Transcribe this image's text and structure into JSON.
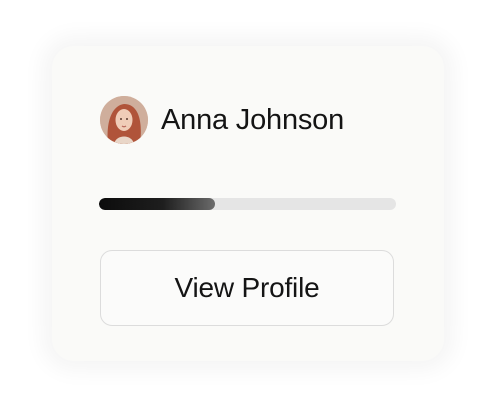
{
  "profile": {
    "name": "Anna Johnson",
    "avatar_icon": "user-avatar-photo"
  },
  "progress": {
    "value": 0.39
  },
  "actions": {
    "view_profile_label": "View Profile"
  },
  "colors": {
    "card_background": "#fafaf8",
    "progress_fill": "#111111",
    "progress_track": "#e5e5e5",
    "button_border": "#dcdcdc",
    "text": "#141414"
  }
}
